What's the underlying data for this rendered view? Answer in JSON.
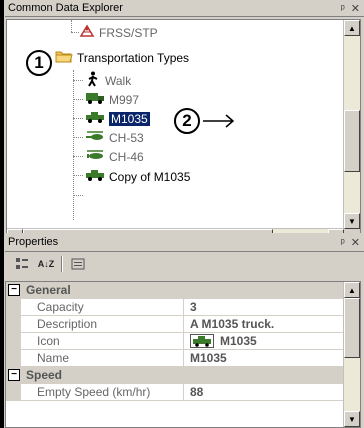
{
  "explorer": {
    "title": "Common Data Explorer",
    "pin_icon": "pin-icon",
    "close_icon": "close-icon"
  },
  "tree": {
    "items": [
      {
        "label": "FRSS/STP",
        "icon": "frss-icon"
      },
      {
        "label": "Transportation Types",
        "icon": "folder-icon"
      },
      {
        "label": "Walk",
        "icon": "walk-icon"
      },
      {
        "label": "M997",
        "icon": "truck-icon"
      },
      {
        "label": "M1035",
        "icon": "truck-icon"
      },
      {
        "label": "CH-53",
        "icon": "helicopter-icon"
      },
      {
        "label": "CH-46",
        "icon": "helicopter-icon"
      },
      {
        "label": "Copy of M1035",
        "icon": "truck-icon"
      }
    ]
  },
  "callouts": {
    "one": "1",
    "two": "2",
    "arrow": "⟶"
  },
  "properties": {
    "title": "Properties",
    "pin_icon": "pin-icon",
    "close_icon": "close-icon",
    "sort_az": "A↓Z",
    "categories": [
      {
        "name": "General",
        "toggle": "−",
        "rows": [
          {
            "name": "Capacity",
            "value": "3"
          },
          {
            "name": "Description",
            "value": "A M1035 truck."
          },
          {
            "name": "Icon",
            "value": "M1035"
          },
          {
            "name": "Name",
            "value": "M1035"
          }
        ]
      },
      {
        "name": "Speed",
        "toggle": "−",
        "rows": [
          {
            "name": "Empty Speed (km/hr)",
            "value": "88"
          }
        ]
      }
    ]
  },
  "colors": {
    "selection": "#0a246a",
    "chrome": "#d4d0c8",
    "truck_green": "#3a7a2a"
  }
}
